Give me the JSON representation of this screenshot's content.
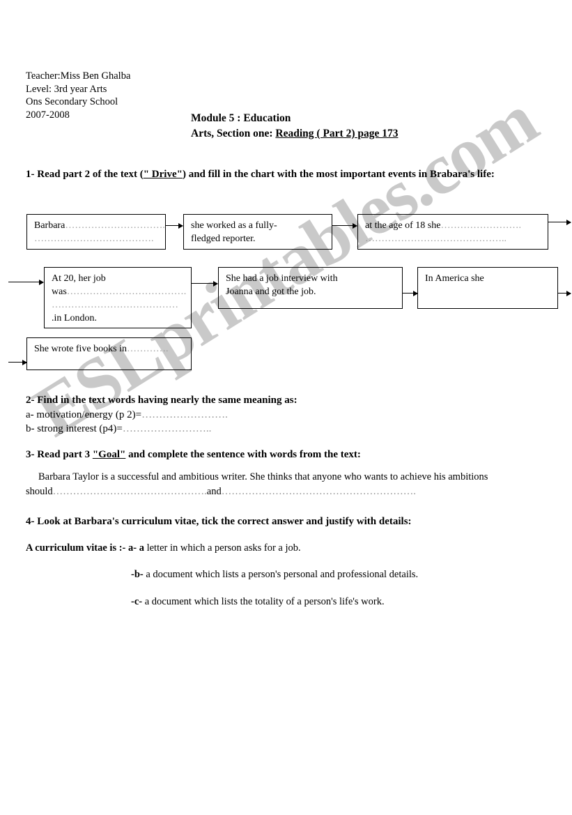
{
  "header": {
    "teacher": "Teacher:Miss Ben Ghalba",
    "level": "Level: 3rd year Arts",
    "school": "Ons Secondary School",
    "year": "2007-2008"
  },
  "title": {
    "module": "Module 5 : Education",
    "section_prefix": "Arts, Section one: ",
    "section_underlined": "Reading ( Part 2) page 173"
  },
  "questions": {
    "q1": {
      "prefix": "1- Read part 2 of the text (",
      "underlined": "\" Drive\"",
      "suffix": ") and fill in the chart with the most important events in Brabara's life:"
    },
    "q2": {
      "heading": "2- Find in the text words having nearly the same meaning as:",
      "item_a": "a- motivation/energy (p 2)=",
      "item_a_dots": "…………………….",
      "item_b": "b- strong interest (p4)=",
      "item_b_dots": "…………………….."
    },
    "q3": {
      "prefix": "3- Read part 3  ",
      "underlined": "\"Goal\"",
      "suffix": " and complete the sentence with words from the text:",
      "paragraph_1": "Barbara  Taylor is a successful and ambitious writer. She thinks that anyone who wants to achieve his",
      "paragraph_2_start": "ambitions should",
      "paragraph_2_dots1": "……………………………………….",
      "paragraph_2_and": "and",
      "paragraph_2_dots2": "…………………………………………………."
    },
    "q4": {
      "heading": "4- Look at Barbara's curriculum vitae, tick the correct answer and justify with details:",
      "stem": "A curriculum vitae is :- a- a",
      "option_a": " letter in which a person asks for a job.",
      "option_b_label": "-b-",
      "option_b": " a document which lists a person's personal and professional details.",
      "option_c_label": "-c-",
      "option_c": " a document which lists the totality of a person's life's work."
    }
  },
  "chart_data": {
    "type": "diagram",
    "title": "Barbara's life events flow chart",
    "boxes": [
      {
        "id": "box1",
        "lines": [
          "Barbara",
          "……………………………",
          "……………………………"
        ],
        "text_line1": "Barbara",
        "dots_line1": "………………………….",
        "dots_line2": "………………………………."
      },
      {
        "id": "box2",
        "text_line1": "she worked as a fully-",
        "text_line2": "fledged reporter."
      },
      {
        "id": "box3",
        "text_line1": "at  the age  of 18 she",
        "dots_line1": "…………………….",
        "dots_line2": "…………………………………….."
      },
      {
        "id": "box4",
        "text_line1": "At 20, her job",
        "text_line2": "was",
        "dots_line2": "……………………………….",
        "dots_line3": "…………………………………",
        "text_line4": ".in London."
      },
      {
        "id": "box5",
        "text_line1": "She had a job interview with",
        "text_line2": "Joanna and got the job."
      },
      {
        "id": "box6",
        "text_line1": "In America she"
      },
      {
        "id": "box7",
        "text_line1": "She wrote five books in",
        "dots_line1": "…………."
      }
    ],
    "arrow_count": 8
  },
  "watermark": {
    "text": "ESLprintables.com",
    "color": "#c9c9c9"
  }
}
